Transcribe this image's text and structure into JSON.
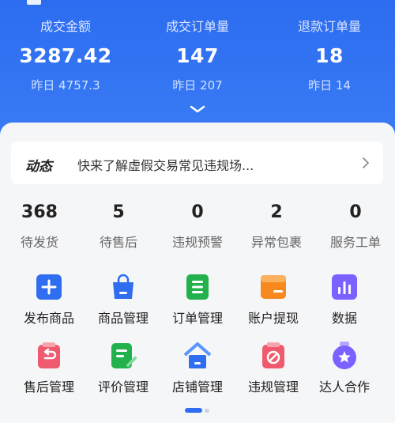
{
  "stats": [
    {
      "label": "成交金额",
      "value": "3287.42",
      "prev": "昨日 4757.3"
    },
    {
      "label": "成交订单量",
      "value": "147",
      "prev": "昨日 207"
    },
    {
      "label": "退款订单量",
      "value": "18",
      "prev": "昨日 14"
    }
  ],
  "news": {
    "tag": "动态",
    "text": "快来了解虚假交易常见违规场..."
  },
  "counts": [
    {
      "num": "368",
      "label": "待发货"
    },
    {
      "num": "5",
      "label": "待售后"
    },
    {
      "num": "0",
      "label": "违规预警"
    },
    {
      "num": "2",
      "label": "异常包裹"
    },
    {
      "num": "0",
      "label": "服务工单"
    }
  ],
  "tools_row1": [
    {
      "label": "发布商品",
      "icon": "plus-icon",
      "color": "#2f6ef0"
    },
    {
      "label": "商品管理",
      "icon": "shopping-bag-icon",
      "color": "#2f6ef0"
    },
    {
      "label": "订单管理",
      "icon": "order-list-icon",
      "color": "#22b14c"
    },
    {
      "label": "账户提现",
      "icon": "wallet-icon",
      "color": "#f7891e"
    },
    {
      "label": "数据",
      "icon": "bar-chart-icon",
      "color": "#7b61ff"
    }
  ],
  "tools_row2": [
    {
      "label": "售后管理",
      "icon": "return-icon",
      "color": "#f05a6e"
    },
    {
      "label": "评价管理",
      "icon": "review-icon",
      "color": "#22b14c"
    },
    {
      "label": "店铺管理",
      "icon": "home-icon",
      "color": "#2f6ef0"
    },
    {
      "label": "违规管理",
      "icon": "prohibit-icon",
      "color": "#f05a6e"
    },
    {
      "label": "达人合作",
      "icon": "star-badge-icon",
      "color": "#7b61ff"
    }
  ]
}
